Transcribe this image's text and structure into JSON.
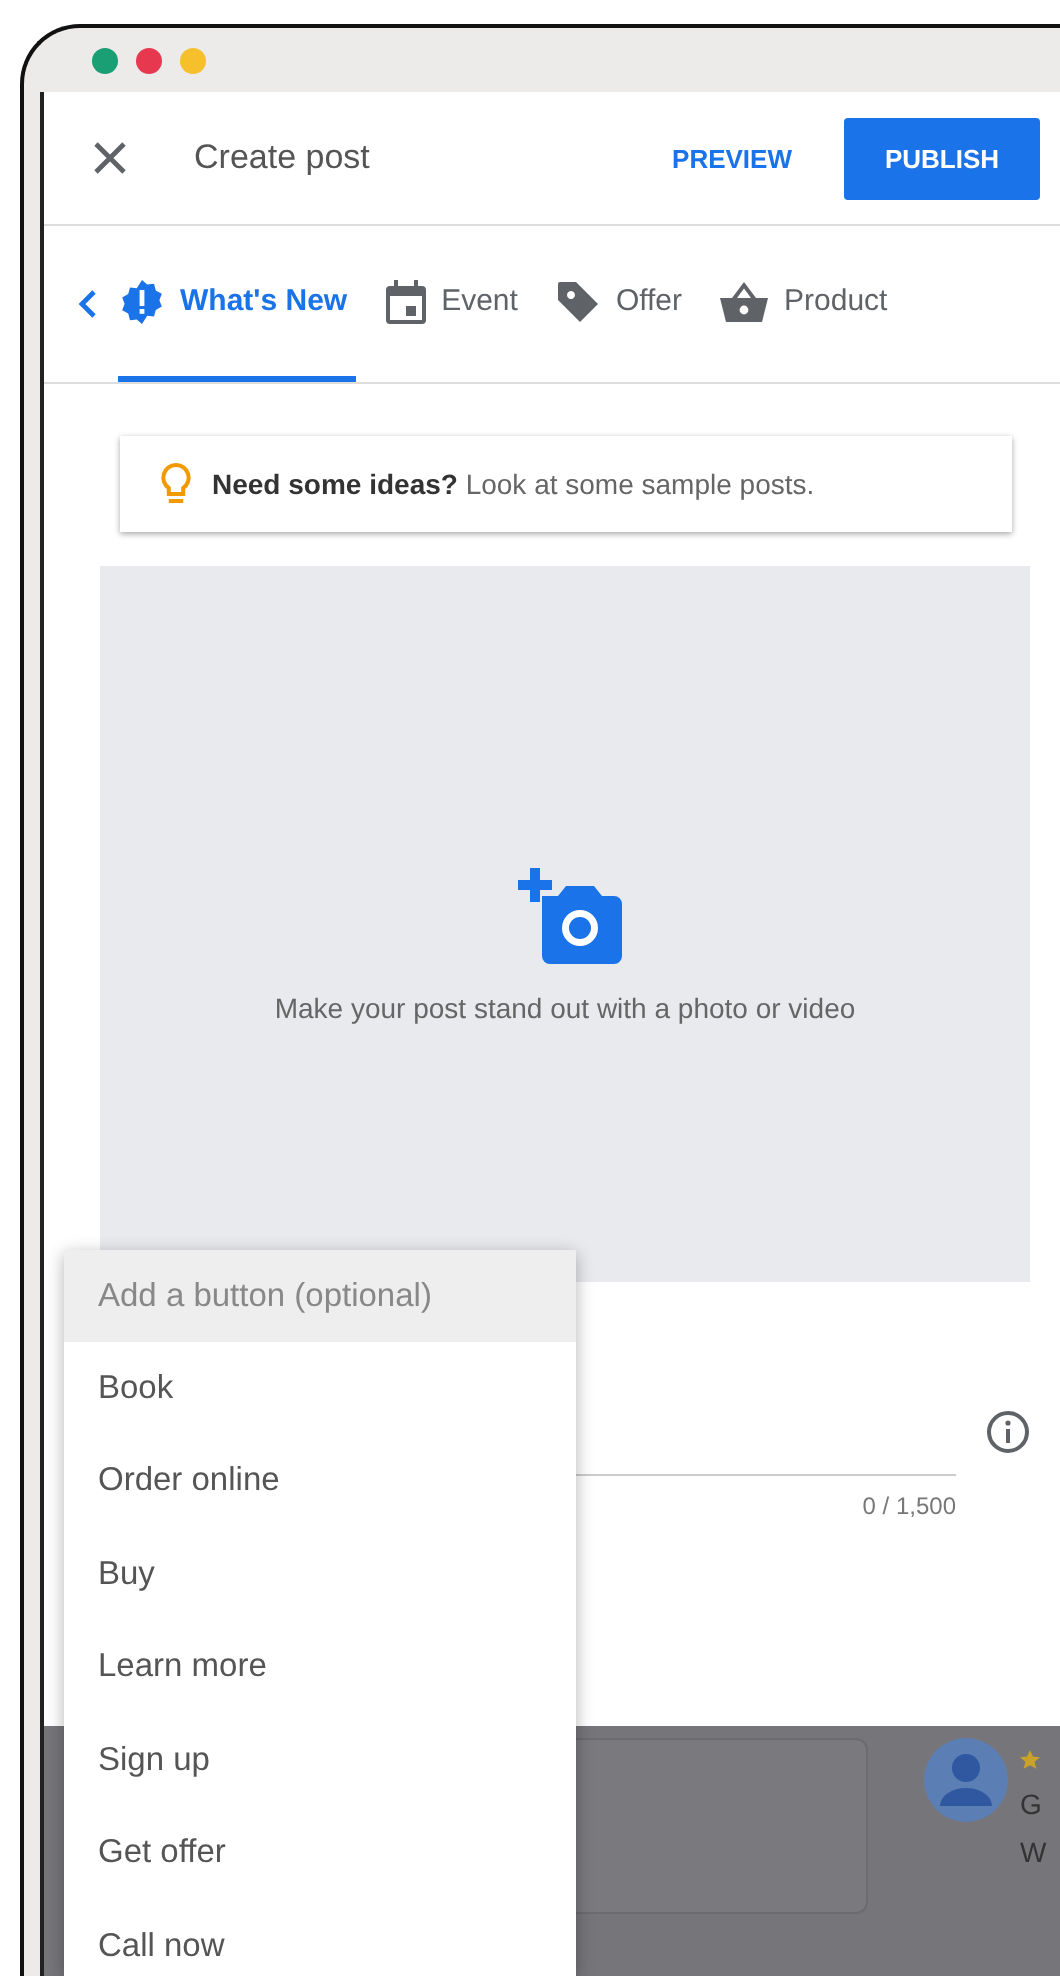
{
  "window": {
    "controls": [
      {
        "color": "#1a9e74"
      },
      {
        "color": "#e6384f"
      },
      {
        "color": "#f5c02c"
      }
    ]
  },
  "header": {
    "title": "Create post",
    "preview": "PREVIEW",
    "publish": "PUBLISH"
  },
  "tabs": [
    {
      "label": "What's New",
      "selected": true,
      "kind": "news"
    },
    {
      "label": "Event",
      "selected": false,
      "kind": "event"
    },
    {
      "label": "Offer",
      "selected": false,
      "kind": "offer"
    },
    {
      "label": "Product",
      "selected": false,
      "kind": "product"
    }
  ],
  "tip": {
    "text": "**Need some ideas?** Look at some sample posts."
  },
  "media": {
    "prompt": "Make your post stand out with a photo or video"
  },
  "description": {
    "counter": "0 / 1,500"
  },
  "button_menu": {
    "placeholder": "Add a button (optional)",
    "options": [
      "Book",
      "Order online",
      "Buy",
      "Learn more",
      "Sign up",
      "Get offer",
      "Call now"
    ]
  },
  "background": {
    "review_lines": [
      "G",
      "W"
    ]
  }
}
